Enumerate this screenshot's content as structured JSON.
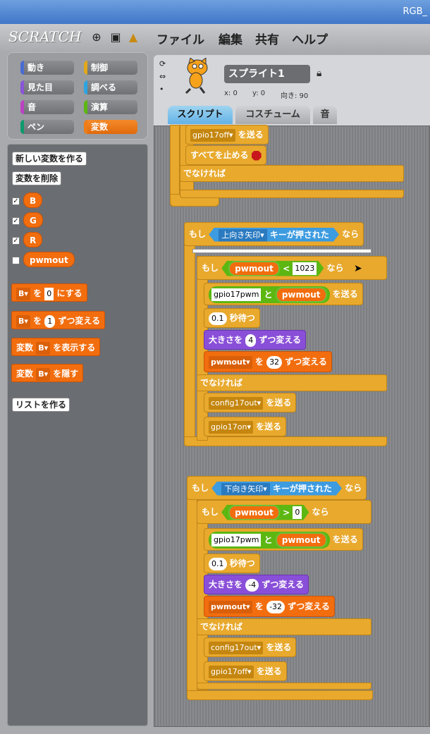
{
  "window": {
    "title": "RGB_"
  },
  "app": {
    "logo": "SCRATCH",
    "menus": [
      "ファイル",
      "編集",
      "共有",
      "ヘルプ"
    ]
  },
  "categories": [
    {
      "label": "動き",
      "color": "#4a6cd4"
    },
    {
      "label": "制御",
      "color": "#e1a91a"
    },
    {
      "label": "見た目",
      "color": "#8a55d7"
    },
    {
      "label": "調べる",
      "color": "#2ca5e2"
    },
    {
      "label": "音",
      "color": "#bb42c3"
    },
    {
      "label": "演算",
      "color": "#5cb712"
    },
    {
      "label": "ペン",
      "color": "#0e9a6c"
    },
    {
      "label": "変数",
      "color": "#ee7d16"
    }
  ],
  "palette": {
    "new_var": "新しい変数を作る",
    "del_var": "変数を削除",
    "vars": [
      "B",
      "G",
      "R",
      "pwmout"
    ],
    "set_pre": "B",
    "set_mid": "を",
    "set_val": "0",
    "set_post": "にする",
    "change_pre": "B",
    "change_mid": "を",
    "change_val": "1",
    "change_post": "ずつ変える",
    "show_a": "変数",
    "show_b": "B",
    "show_c": "を表示する",
    "hide_a": "変数",
    "hide_b": "B",
    "hide_c": "を隠す",
    "make_list": "リストを作る"
  },
  "sprite": {
    "name": "スプライト1",
    "x": "x: 0",
    "y": "y: 0",
    "dir": "向き: 90"
  },
  "tabs": [
    "スクリプト",
    "コスチューム",
    "音"
  ],
  "script": {
    "top": {
      "send1": "gpio17off",
      "send_lbl": "を送る",
      "stop": "すべてを止める",
      "else": "でなければ"
    },
    "g1": {
      "if": "もし",
      "key": "上向き矢印",
      "pressed": "キーが押された",
      "then": "なら",
      "cond_var": "pwmout",
      "op": "<",
      "cond_val": "1023",
      "join_a": "gpio17pwm",
      "join_and": "と",
      "join_b": "pwmout",
      "send": "を送る",
      "wait_val": "0.1",
      "wait": "秒待つ",
      "size_a": "大きさを",
      "size_val": "4",
      "size_b": "ずつ変える",
      "chg_var": "pwmout",
      "chg_mid": "を",
      "chg_val": "32",
      "chg_post": "ずつ変える",
      "else": "でなければ",
      "b1": "config17out",
      "b2": "gpio17on"
    },
    "g2": {
      "if": "もし",
      "key": "下向き矢印",
      "pressed": "キーが押された",
      "then": "なら",
      "cond_var": "pwmout",
      "op": ">",
      "cond_val": "0",
      "join_a": "gpio17pwm",
      "join_and": "と",
      "join_b": "pwmout",
      "send": "を送る",
      "wait_val": "0.1",
      "wait": "秒待つ",
      "size_a": "大きさを",
      "size_val": "-4",
      "size_b": "ずつ変える",
      "chg_var": "pwmout",
      "chg_mid": "を",
      "chg_val": "-32",
      "chg_post": "ずつ変える",
      "else": "でなければ",
      "b1": "config17out",
      "b2": "gpio17off"
    }
  }
}
